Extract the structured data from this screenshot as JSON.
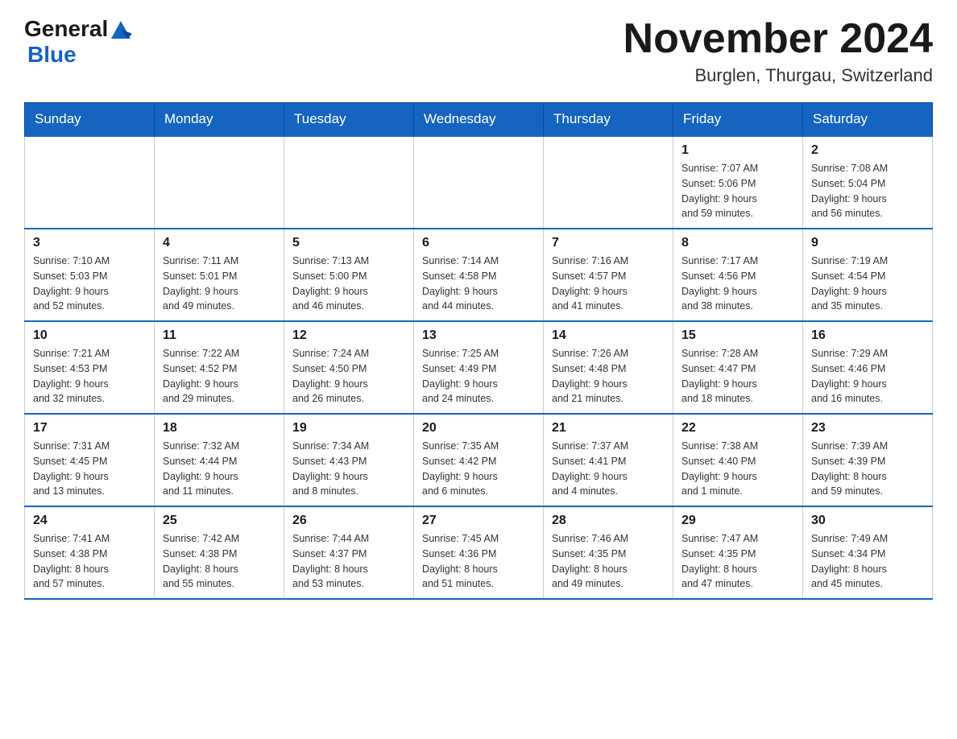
{
  "header": {
    "logo_general": "General",
    "logo_blue": "Blue",
    "month_title": "November 2024",
    "location": "Burglen, Thurgau, Switzerland"
  },
  "days_of_week": [
    "Sunday",
    "Monday",
    "Tuesday",
    "Wednesday",
    "Thursday",
    "Friday",
    "Saturday"
  ],
  "weeks": [
    [
      {
        "day": "",
        "info": ""
      },
      {
        "day": "",
        "info": ""
      },
      {
        "day": "",
        "info": ""
      },
      {
        "day": "",
        "info": ""
      },
      {
        "day": "",
        "info": ""
      },
      {
        "day": "1",
        "info": "Sunrise: 7:07 AM\nSunset: 5:06 PM\nDaylight: 9 hours\nand 59 minutes."
      },
      {
        "day": "2",
        "info": "Sunrise: 7:08 AM\nSunset: 5:04 PM\nDaylight: 9 hours\nand 56 minutes."
      }
    ],
    [
      {
        "day": "3",
        "info": "Sunrise: 7:10 AM\nSunset: 5:03 PM\nDaylight: 9 hours\nand 52 minutes."
      },
      {
        "day": "4",
        "info": "Sunrise: 7:11 AM\nSunset: 5:01 PM\nDaylight: 9 hours\nand 49 minutes."
      },
      {
        "day": "5",
        "info": "Sunrise: 7:13 AM\nSunset: 5:00 PM\nDaylight: 9 hours\nand 46 minutes."
      },
      {
        "day": "6",
        "info": "Sunrise: 7:14 AM\nSunset: 4:58 PM\nDaylight: 9 hours\nand 44 minutes."
      },
      {
        "day": "7",
        "info": "Sunrise: 7:16 AM\nSunset: 4:57 PM\nDaylight: 9 hours\nand 41 minutes."
      },
      {
        "day": "8",
        "info": "Sunrise: 7:17 AM\nSunset: 4:56 PM\nDaylight: 9 hours\nand 38 minutes."
      },
      {
        "day": "9",
        "info": "Sunrise: 7:19 AM\nSunset: 4:54 PM\nDaylight: 9 hours\nand 35 minutes."
      }
    ],
    [
      {
        "day": "10",
        "info": "Sunrise: 7:21 AM\nSunset: 4:53 PM\nDaylight: 9 hours\nand 32 minutes."
      },
      {
        "day": "11",
        "info": "Sunrise: 7:22 AM\nSunset: 4:52 PM\nDaylight: 9 hours\nand 29 minutes."
      },
      {
        "day": "12",
        "info": "Sunrise: 7:24 AM\nSunset: 4:50 PM\nDaylight: 9 hours\nand 26 minutes."
      },
      {
        "day": "13",
        "info": "Sunrise: 7:25 AM\nSunset: 4:49 PM\nDaylight: 9 hours\nand 24 minutes."
      },
      {
        "day": "14",
        "info": "Sunrise: 7:26 AM\nSunset: 4:48 PM\nDaylight: 9 hours\nand 21 minutes."
      },
      {
        "day": "15",
        "info": "Sunrise: 7:28 AM\nSunset: 4:47 PM\nDaylight: 9 hours\nand 18 minutes."
      },
      {
        "day": "16",
        "info": "Sunrise: 7:29 AM\nSunset: 4:46 PM\nDaylight: 9 hours\nand 16 minutes."
      }
    ],
    [
      {
        "day": "17",
        "info": "Sunrise: 7:31 AM\nSunset: 4:45 PM\nDaylight: 9 hours\nand 13 minutes."
      },
      {
        "day": "18",
        "info": "Sunrise: 7:32 AM\nSunset: 4:44 PM\nDaylight: 9 hours\nand 11 minutes."
      },
      {
        "day": "19",
        "info": "Sunrise: 7:34 AM\nSunset: 4:43 PM\nDaylight: 9 hours\nand 8 minutes."
      },
      {
        "day": "20",
        "info": "Sunrise: 7:35 AM\nSunset: 4:42 PM\nDaylight: 9 hours\nand 6 minutes."
      },
      {
        "day": "21",
        "info": "Sunrise: 7:37 AM\nSunset: 4:41 PM\nDaylight: 9 hours\nand 4 minutes."
      },
      {
        "day": "22",
        "info": "Sunrise: 7:38 AM\nSunset: 4:40 PM\nDaylight: 9 hours\nand 1 minute."
      },
      {
        "day": "23",
        "info": "Sunrise: 7:39 AM\nSunset: 4:39 PM\nDaylight: 8 hours\nand 59 minutes."
      }
    ],
    [
      {
        "day": "24",
        "info": "Sunrise: 7:41 AM\nSunset: 4:38 PM\nDaylight: 8 hours\nand 57 minutes."
      },
      {
        "day": "25",
        "info": "Sunrise: 7:42 AM\nSunset: 4:38 PM\nDaylight: 8 hours\nand 55 minutes."
      },
      {
        "day": "26",
        "info": "Sunrise: 7:44 AM\nSunset: 4:37 PM\nDaylight: 8 hours\nand 53 minutes."
      },
      {
        "day": "27",
        "info": "Sunrise: 7:45 AM\nSunset: 4:36 PM\nDaylight: 8 hours\nand 51 minutes."
      },
      {
        "day": "28",
        "info": "Sunrise: 7:46 AM\nSunset: 4:35 PM\nDaylight: 8 hours\nand 49 minutes."
      },
      {
        "day": "29",
        "info": "Sunrise: 7:47 AM\nSunset: 4:35 PM\nDaylight: 8 hours\nand 47 minutes."
      },
      {
        "day": "30",
        "info": "Sunrise: 7:49 AM\nSunset: 4:34 PM\nDaylight: 8 hours\nand 45 minutes."
      }
    ]
  ]
}
